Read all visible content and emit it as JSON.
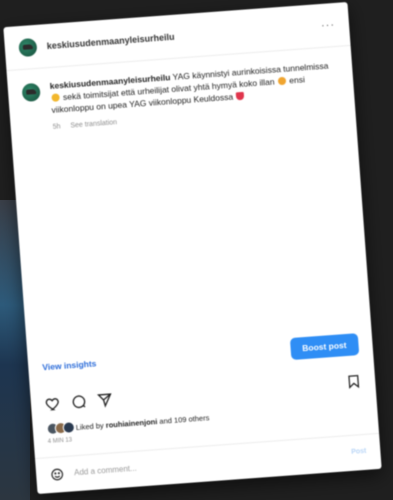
{
  "post": {
    "username": "keskiusudenmaanyleisurheilu",
    "more_label": "···",
    "caption": {
      "username": "keskiusudenmaanyleisurheilu",
      "part1": "YAG käynnistyi aurinkoisissa tunnelmissa",
      "part2": "sekä toimitsijat että urheilijat olivat yhtä hymyä koko illan",
      "part3": "ensi viikonloppu on upea YAG viikonloppu Keuldossa"
    },
    "time_ago": "5h",
    "see_translation": "See translation",
    "view_insights": "View insights",
    "boost_label": "Boost post",
    "likes": {
      "prefix": "Liked by",
      "user": "rouhiainenjoni",
      "suffix": "and 109 others"
    },
    "date": "4 MIN 13",
    "comment_placeholder": "Add a comment...",
    "post_label": "Post"
  },
  "icons": [
    "avatar",
    "heart-icon",
    "comment-icon",
    "share-icon",
    "save-icon",
    "emoji-icon"
  ],
  "colors": {
    "accent": "#2f8ef5",
    "link": "#2b6cd9",
    "background": "#1f1f1f"
  }
}
